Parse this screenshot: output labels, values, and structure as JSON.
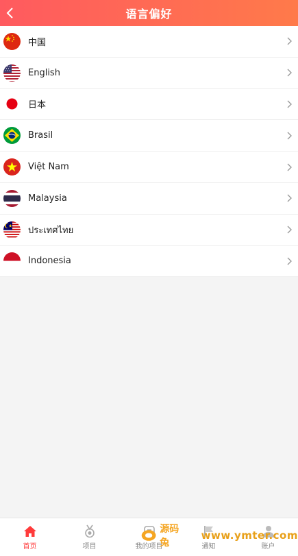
{
  "header": {
    "title": "语言偏好"
  },
  "languages": [
    {
      "label": "中国",
      "flag": "china-flag"
    },
    {
      "label": "English",
      "flag": "usa-flag"
    },
    {
      "label": "日本",
      "flag": "japan-flag"
    },
    {
      "label": "Brasil",
      "flag": "brazil-flag"
    },
    {
      "label": "Việt Nam",
      "flag": "vietnam-flag"
    },
    {
      "label": "Malaysia",
      "flag": "thailand-flag"
    },
    {
      "label": "ประเทศไทย",
      "flag": "malaysia-flag"
    },
    {
      "label": "Indonesia",
      "flag": "indonesia-flag"
    }
  ],
  "tabs": [
    {
      "label": "首页",
      "icon": "home-icon",
      "active": true
    },
    {
      "label": "项目",
      "icon": "medal-icon",
      "active": false
    },
    {
      "label": "我的项目",
      "icon": "project-icon",
      "active": false
    },
    {
      "label": "通知",
      "icon": "flag-icon",
      "active": false
    },
    {
      "label": "账户",
      "icon": "user-icon",
      "active": false
    }
  ],
  "watermark": {
    "cn": "源码兔",
    "url": "www.ymter.com"
  },
  "colors": {
    "header_start": "#ff5a5f",
    "header_end": "#ff7a4a",
    "active": "#ff3b3b",
    "inactive": "#888888"
  }
}
